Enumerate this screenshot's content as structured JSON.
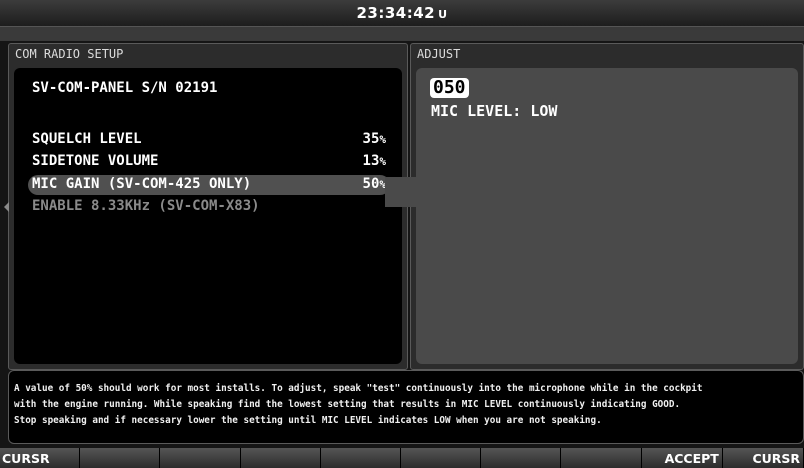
{
  "header": {
    "time": "23:34:42",
    "time_suffix": "U"
  },
  "left_panel": {
    "title": "COM RADIO SETUP",
    "serial": "SV-COM-PANEL S/N 02191",
    "items": [
      {
        "label": "SQUELCH LEVEL",
        "value": "35",
        "unit": "%"
      },
      {
        "label": "SIDETONE VOLUME",
        "value": "13",
        "unit": "%"
      },
      {
        "label": "MIC GAIN (SV-COM-425 ONLY)",
        "value": "50",
        "unit": "%"
      },
      {
        "label": "ENABLE 8.33KHz (SV-COM-X83)",
        "value": "",
        "unit": ""
      }
    ]
  },
  "right_panel": {
    "title": "ADJUST",
    "value": "050",
    "status": "MIC LEVEL: LOW"
  },
  "help": {
    "line1": "A value of 50% should work for most installs. To adjust, speak \"test\" continuously into the microphone while in the cockpit",
    "line2": "with the engine running. While speaking find the lowest setting that results in MIC LEVEL continuously indicating GOOD.",
    "line3": "Stop speaking and if necessary lower the setting until MIC LEVEL indicates LOW when you are not speaking."
  },
  "softkeys": [
    "CURSR",
    "",
    "",
    "",
    "",
    "",
    "",
    "",
    "ACCEPT",
    "CURSR"
  ]
}
